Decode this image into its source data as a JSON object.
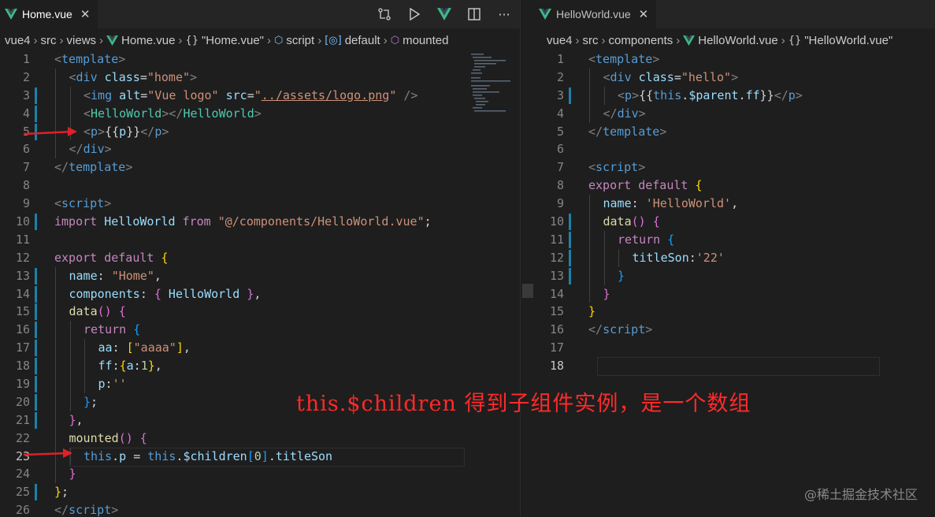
{
  "left": {
    "tab_label": "Home.vue",
    "tab_close": "✕",
    "actions": [
      "git-compare-icon",
      "run-icon",
      "vue-devtools-icon",
      "split-editor-icon",
      "more-actions-icon"
    ],
    "more_label": "···",
    "breadcrumb": [
      "vue4",
      "src",
      "views",
      "Home.vue",
      "\"Home.vue\"",
      "script",
      "default",
      "mounted"
    ],
    "lines": [
      {
        "n": "1",
        "toks": [
          [
            "tg",
            "<"
          ],
          [
            "tn",
            "template"
          ],
          [
            "tg",
            ">"
          ]
        ],
        "indent": 0
      },
      {
        "n": "2",
        "toks": [
          [
            "tg",
            "<"
          ],
          [
            "tn",
            "div"
          ],
          [
            "at",
            " class"
          ],
          [
            "tx",
            "="
          ],
          [
            "st",
            "\"home\""
          ],
          [
            "tg",
            ">"
          ]
        ],
        "indent": 1
      },
      {
        "n": "3",
        "toks": [
          [
            "tg",
            "<"
          ],
          [
            "tn",
            "img"
          ],
          [
            "at",
            " alt"
          ],
          [
            "tx",
            "="
          ],
          [
            "st",
            "\"Vue logo\""
          ],
          [
            "at",
            " src"
          ],
          [
            "tx",
            "="
          ],
          [
            "st",
            "\""
          ],
          [
            "st u",
            "../assets/logo.png"
          ],
          [
            "st",
            "\""
          ],
          [
            "tg",
            " />"
          ]
        ],
        "indent": 2,
        "gut": true
      },
      {
        "n": "4",
        "toks": [
          [
            "tg",
            "<"
          ],
          [
            "cl",
            "HelloWorld"
          ],
          [
            "tg",
            "></"
          ],
          [
            "cl",
            "HelloWorld"
          ],
          [
            "tg",
            ">"
          ]
        ],
        "indent": 2,
        "gut": true
      },
      {
        "n": "5",
        "toks": [
          [
            "tg",
            "<"
          ],
          [
            "tn",
            "p"
          ],
          [
            "tg",
            ">"
          ],
          [
            "tx",
            "{{"
          ],
          [
            "vr",
            "p"
          ],
          [
            "tx",
            "}}"
          ],
          [
            "tg",
            "</"
          ],
          [
            "tn",
            "p"
          ],
          [
            "tg",
            ">"
          ]
        ],
        "indent": 2,
        "gut": true
      },
      {
        "n": "6",
        "toks": [
          [
            "tg",
            "</"
          ],
          [
            "tn",
            "div"
          ],
          [
            "tg",
            ">"
          ]
        ],
        "indent": 1
      },
      {
        "n": "7",
        "toks": [
          [
            "tg",
            "</"
          ],
          [
            "tn",
            "template"
          ],
          [
            "tg",
            ">"
          ]
        ],
        "indent": 0
      },
      {
        "n": "8",
        "toks": [],
        "indent": 0
      },
      {
        "n": "9",
        "toks": [
          [
            "tg",
            "<"
          ],
          [
            "tn",
            "script"
          ],
          [
            "tg",
            ">"
          ]
        ],
        "indent": 0
      },
      {
        "n": "10",
        "toks": [
          [
            "kw",
            "import"
          ],
          [
            "vr",
            " HelloWorld"
          ],
          [
            "kw",
            " from"
          ],
          [
            "st",
            " \"@/components/HelloWorld.vue\""
          ],
          [
            "tx",
            ";"
          ]
        ],
        "indent": 0,
        "gut": true
      },
      {
        "n": "11",
        "toks": [],
        "indent": 0
      },
      {
        "n": "12",
        "toks": [
          [
            "kw",
            "export"
          ],
          [
            "kw",
            " default"
          ],
          [
            "br1",
            " {"
          ]
        ],
        "indent": 0
      },
      {
        "n": "13",
        "toks": [
          [
            "vr",
            "name"
          ],
          [
            "tx",
            ": "
          ],
          [
            "st",
            "\"Home\""
          ],
          [
            "tx",
            ","
          ]
        ],
        "indent": 1,
        "gut": true
      },
      {
        "n": "14",
        "toks": [
          [
            "vr",
            "components"
          ],
          [
            "tx",
            ": "
          ],
          [
            "br2",
            "{"
          ],
          [
            "vr",
            " HelloWorld"
          ],
          [
            "br2",
            " }"
          ],
          [
            "tx",
            ","
          ]
        ],
        "indent": 1,
        "gut": true
      },
      {
        "n": "15",
        "toks": [
          [
            "fn",
            "data"
          ],
          [
            "br2",
            "()"
          ],
          [
            "br2",
            " {"
          ]
        ],
        "indent": 1,
        "gut": true
      },
      {
        "n": "16",
        "toks": [
          [
            "kw",
            "return"
          ],
          [
            "br3",
            " {"
          ]
        ],
        "indent": 2,
        "gut": true
      },
      {
        "n": "17",
        "toks": [
          [
            "vr",
            "aa"
          ],
          [
            "tx",
            ": "
          ],
          [
            "br1",
            "["
          ],
          [
            "st",
            "\"aaaa\""
          ],
          [
            "br1",
            "]"
          ],
          [
            "tx",
            ","
          ]
        ],
        "indent": 3,
        "gut": true
      },
      {
        "n": "18",
        "toks": [
          [
            "vr",
            "ff"
          ],
          [
            "tx",
            ":"
          ],
          [
            "br1",
            "{"
          ],
          [
            "vr",
            "a"
          ],
          [
            "tx",
            ":"
          ],
          [
            "nm",
            "1"
          ],
          [
            "br1",
            "}"
          ],
          [
            "tx",
            ","
          ]
        ],
        "indent": 3,
        "gut": true
      },
      {
        "n": "19",
        "toks": [
          [
            "vr",
            "p"
          ],
          [
            "tx",
            ":"
          ],
          [
            "st",
            "''"
          ]
        ],
        "indent": 3,
        "gut": true
      },
      {
        "n": "20",
        "toks": [
          [
            "br3",
            "}"
          ],
          [
            "tx",
            ";"
          ]
        ],
        "indent": 2,
        "gut": true
      },
      {
        "n": "21",
        "toks": [
          [
            "br2",
            "}"
          ],
          [
            "tx",
            ","
          ]
        ],
        "indent": 1,
        "gut": true
      },
      {
        "n": "22",
        "toks": [
          [
            "fn",
            "mounted"
          ],
          [
            "br2",
            "()"
          ],
          [
            "br2",
            " {"
          ]
        ],
        "indent": 1
      },
      {
        "n": "23",
        "toks": [
          [
            "tn",
            "this"
          ],
          [
            "tx",
            "."
          ],
          [
            "vr",
            "p"
          ],
          [
            "tx",
            " = "
          ],
          [
            "tn",
            "this"
          ],
          [
            "tx",
            "."
          ],
          [
            "vr",
            "$children"
          ],
          [
            "br3",
            "["
          ],
          [
            "nm",
            "0"
          ],
          [
            "br3",
            "]"
          ],
          [
            "tx",
            "."
          ],
          [
            "vr",
            "titleSon"
          ]
        ],
        "indent": 2,
        "cur": true
      },
      {
        "n": "24",
        "toks": [
          [
            "br2",
            "}"
          ]
        ],
        "indent": 1
      },
      {
        "n": "25",
        "toks": [
          [
            "br1",
            "}"
          ],
          [
            "tx",
            ";"
          ]
        ],
        "indent": 0,
        "gut": true
      },
      {
        "n": "26",
        "toks": [
          [
            "tg",
            "</"
          ],
          [
            "tn",
            "script"
          ],
          [
            "tg",
            ">"
          ]
        ],
        "indent": 0
      }
    ]
  },
  "right": {
    "tab_label": "HelloWorld.vue",
    "tab_close": "✕",
    "breadcrumb": [
      "vue4",
      "src",
      "components",
      "HelloWorld.vue",
      "\"HelloWorld.vue\""
    ],
    "lines": [
      {
        "n": "1",
        "toks": [
          [
            "tg",
            "<"
          ],
          [
            "tn",
            "template"
          ],
          [
            "tg",
            ">"
          ]
        ],
        "indent": 0
      },
      {
        "n": "2",
        "toks": [
          [
            "tg",
            "<"
          ],
          [
            "tn",
            "div"
          ],
          [
            "at",
            " class"
          ],
          [
            "tx",
            "="
          ],
          [
            "st",
            "\"hello\""
          ],
          [
            "tg",
            ">"
          ]
        ],
        "indent": 1
      },
      {
        "n": "3",
        "toks": [
          [
            "tg",
            "<"
          ],
          [
            "tn",
            "p"
          ],
          [
            "tg",
            ">"
          ],
          [
            "tx",
            "{{"
          ],
          [
            "tn",
            "this"
          ],
          [
            "tx",
            "."
          ],
          [
            "vr",
            "$parent"
          ],
          [
            "tx",
            "."
          ],
          [
            "vr",
            "ff"
          ],
          [
            "tx",
            "}}"
          ],
          [
            "tg",
            "</"
          ],
          [
            "tn",
            "p"
          ],
          [
            "tg",
            ">"
          ]
        ],
        "indent": 2,
        "gut": true
      },
      {
        "n": "4",
        "toks": [
          [
            "tg",
            "</"
          ],
          [
            "tn",
            "div"
          ],
          [
            "tg",
            ">"
          ]
        ],
        "indent": 1
      },
      {
        "n": "5",
        "toks": [
          [
            "tg",
            "</"
          ],
          [
            "tn",
            "template"
          ],
          [
            "tg",
            ">"
          ]
        ],
        "indent": 0
      },
      {
        "n": "6",
        "toks": [],
        "indent": 0
      },
      {
        "n": "7",
        "toks": [
          [
            "tg",
            "<"
          ],
          [
            "tn",
            "script"
          ],
          [
            "tg",
            ">"
          ]
        ],
        "indent": 0
      },
      {
        "n": "8",
        "toks": [
          [
            "kw",
            "export"
          ],
          [
            "kw",
            " default"
          ],
          [
            "br1",
            " {"
          ]
        ],
        "indent": 0
      },
      {
        "n": "9",
        "toks": [
          [
            "vr",
            "name"
          ],
          [
            "tx",
            ": "
          ],
          [
            "st",
            "'HelloWorld'"
          ],
          [
            "tx",
            ","
          ]
        ],
        "indent": 1
      },
      {
        "n": "10",
        "toks": [
          [
            "fn",
            "data"
          ],
          [
            "br2",
            "()"
          ],
          [
            "br2",
            " {"
          ]
        ],
        "indent": 1,
        "gut": true
      },
      {
        "n": "11",
        "toks": [
          [
            "kw",
            "return"
          ],
          [
            "br3",
            " {"
          ]
        ],
        "indent": 2,
        "gut": true
      },
      {
        "n": "12",
        "toks": [
          [
            "vr",
            "titleSon"
          ],
          [
            "tx",
            ":"
          ],
          [
            "st",
            "'22'"
          ]
        ],
        "indent": 3,
        "gut": true
      },
      {
        "n": "13",
        "toks": [
          [
            "br3",
            "}"
          ]
        ],
        "indent": 2,
        "gut": true
      },
      {
        "n": "14",
        "toks": [
          [
            "br2",
            "}"
          ]
        ],
        "indent": 1
      },
      {
        "n": "15",
        "toks": [
          [
            "br1",
            "}"
          ]
        ],
        "indent": 0
      },
      {
        "n": "16",
        "toks": [
          [
            "tg",
            "</"
          ],
          [
            "tn",
            "script"
          ],
          [
            "tg",
            ">"
          ]
        ],
        "indent": 0
      },
      {
        "n": "17",
        "toks": [],
        "indent": 0
      },
      {
        "n": "18",
        "toks": [],
        "indent": 0,
        "cur": true
      }
    ]
  },
  "annotation": "this.$children 得到子组件实例，是一个数组",
  "watermark": "@稀土掘金技术社区",
  "colors": {
    "accent_gutter": "#1b81a8",
    "arrow": "#e0202a",
    "vue_green": "#41b883"
  }
}
